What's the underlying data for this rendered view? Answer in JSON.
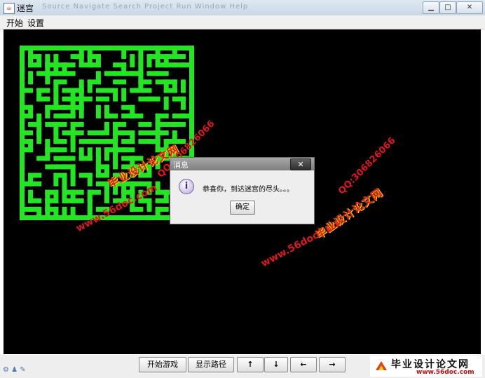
{
  "window": {
    "title": "迷宫",
    "ghost_menu": "Source  Navigate  Search  Project  Run  Window  Help"
  },
  "menubar": {
    "items": [
      "开始",
      "设置"
    ]
  },
  "colors": {
    "maze_wall": "#22e622",
    "canvas_bg": "#000000",
    "watermark": "#e01818"
  },
  "dialog": {
    "title": "消息",
    "icon": "info-icon",
    "message": "恭喜你，到达迷宫的尽头。。。",
    "ok_label": "确定"
  },
  "controls": {
    "start_label": "开始游戏",
    "path_label": "显示路径",
    "up_label": "↑",
    "down_label": "↓",
    "left_label": "←",
    "right_label": "→"
  },
  "watermarks": {
    "site_title": "毕业设计论文网",
    "url": "www.56doc.com",
    "qq": "QQ:306826066"
  },
  "brand": {
    "title": "毕业设计论文网",
    "url": "www.56doc.com"
  }
}
